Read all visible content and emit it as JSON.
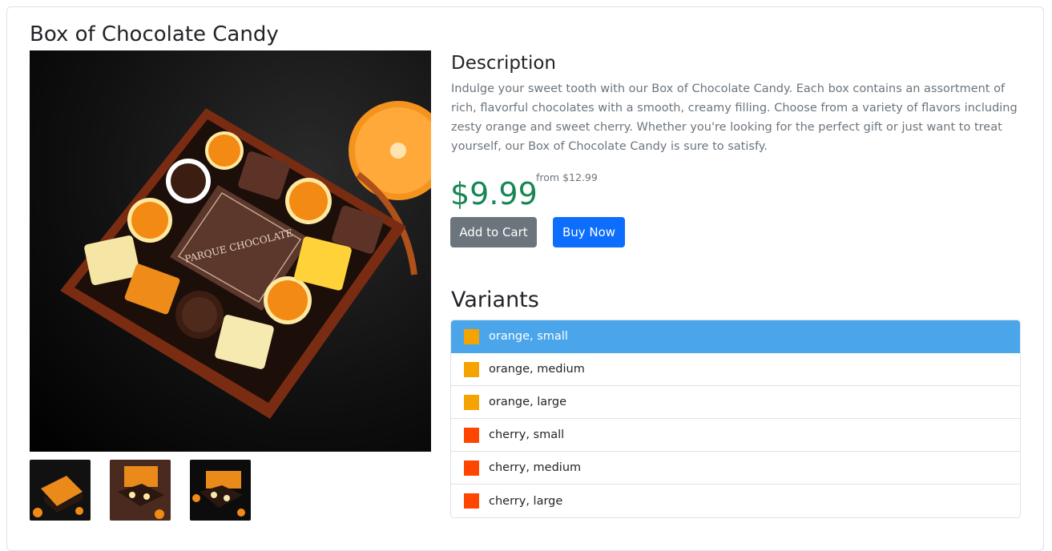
{
  "product": {
    "title": "Box of Chocolate Candy",
    "box_label": "PARQUE CHOCOLATE"
  },
  "description": {
    "heading": "Description",
    "text": "Indulge your sweet tooth with our Box of Chocolate Candy. Each box contains an assortment of rich, flavorful chocolates with a smooth, creamy filling. Choose from a variety of flavors including zesty orange and sweet cherry. Whether you're looking for the perfect gift or just want to treat yourself, our Box of Chocolate Candy is sure to satisfy."
  },
  "pricing": {
    "price": "$9.99",
    "from_price": "from $12.99",
    "price_color": "#198754"
  },
  "actions": {
    "add_to_cart": "Add to Cart",
    "buy_now": "Buy Now"
  },
  "variants": {
    "heading": "Variants",
    "items": [
      {
        "label": "orange, small",
        "swatch": "#f5a300",
        "active": true
      },
      {
        "label": "orange, medium",
        "swatch": "#f5a300",
        "active": false
      },
      {
        "label": "orange, large",
        "swatch": "#f5a300",
        "active": false
      },
      {
        "label": "cherry, small",
        "swatch": "#ff4500",
        "active": false
      },
      {
        "label": "cherry, medium",
        "swatch": "#ff4500",
        "active": false
      },
      {
        "label": "cherry, large",
        "swatch": "#ff4500",
        "active": false
      }
    ]
  },
  "colors": {
    "accent_blue": "#0d6efd",
    "active_variant": "#4ba5ea",
    "secondary": "#6c757d"
  }
}
